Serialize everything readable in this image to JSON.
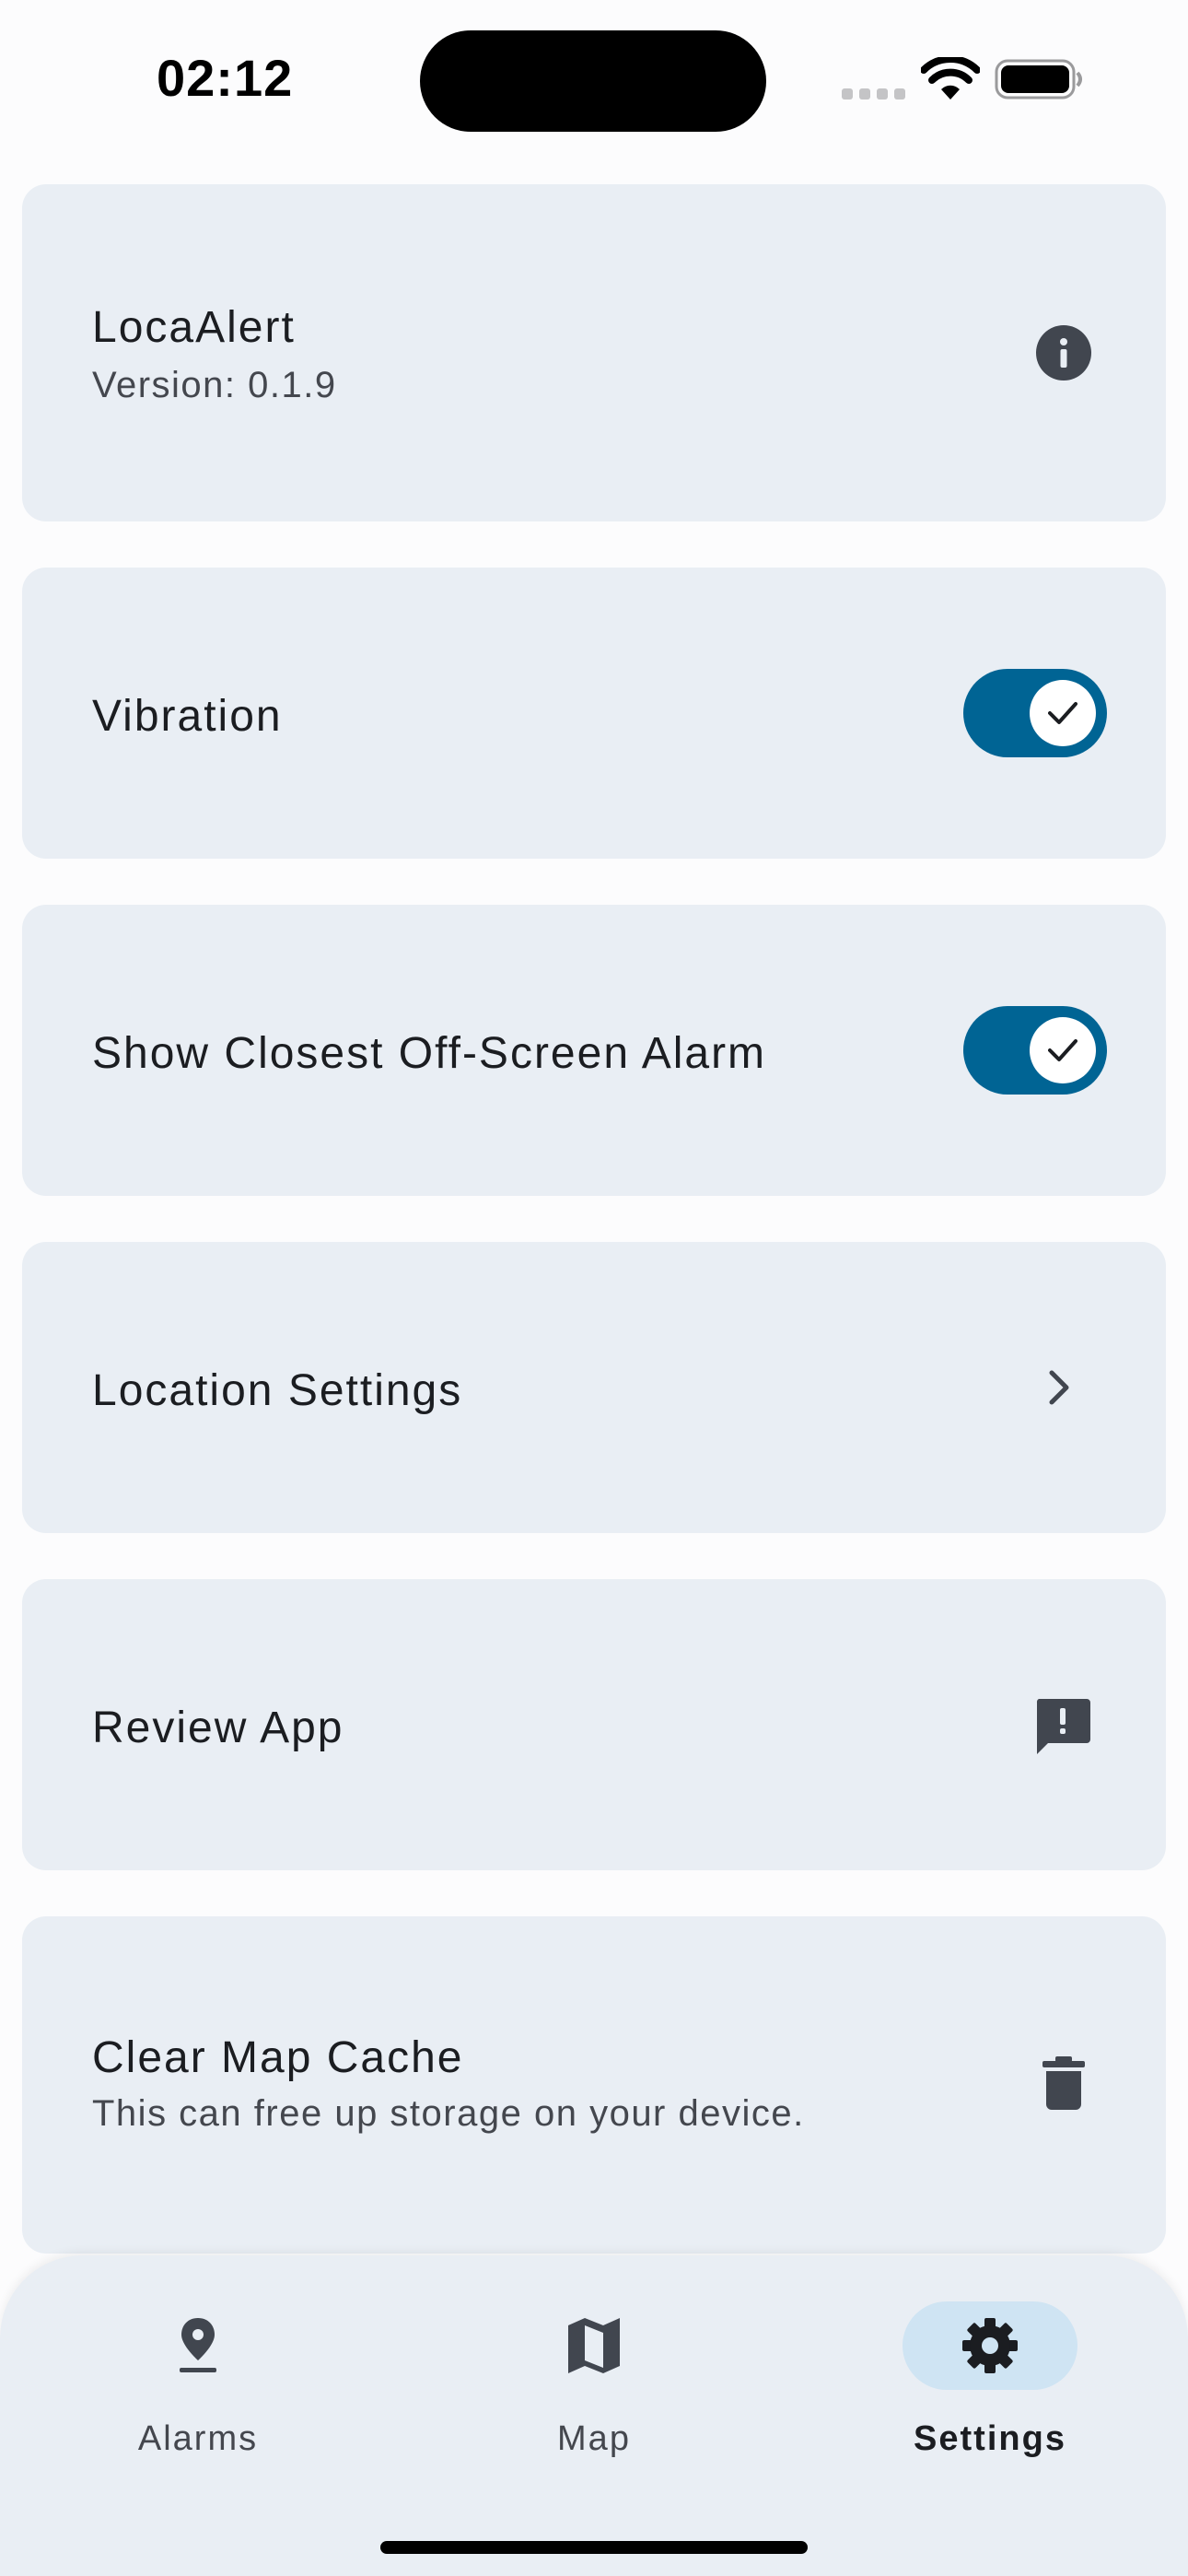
{
  "status_bar": {
    "time": "02:12"
  },
  "app_info": {
    "title": "LocaAlert",
    "version": "Version: 0.1.9",
    "icon": "info-icon"
  },
  "vibration": {
    "label": "Vibration",
    "enabled": true
  },
  "closest_alarm": {
    "label": "Show Closest Off-Screen Alarm",
    "enabled": true
  },
  "location_settings": {
    "label": "Location Settings",
    "icon": "chevron-right-icon"
  },
  "review_app": {
    "label": "Review App",
    "icon": "feedback-icon"
  },
  "clear_cache": {
    "label": "Clear Map Cache",
    "subtitle": "This can free up storage on your device.",
    "icon": "trash-icon"
  },
  "nav": {
    "items": [
      {
        "label": "Alarms",
        "icon": "location-pin-icon",
        "active": false
      },
      {
        "label": "Map",
        "icon": "map-icon",
        "active": false
      },
      {
        "label": "Settings",
        "icon": "gear-icon",
        "active": true
      }
    ]
  },
  "colors": {
    "card_bg": "#e9eef4",
    "toggle_on": "#006494",
    "active_pill": "#cfe4f3",
    "icon": "#41464f"
  }
}
